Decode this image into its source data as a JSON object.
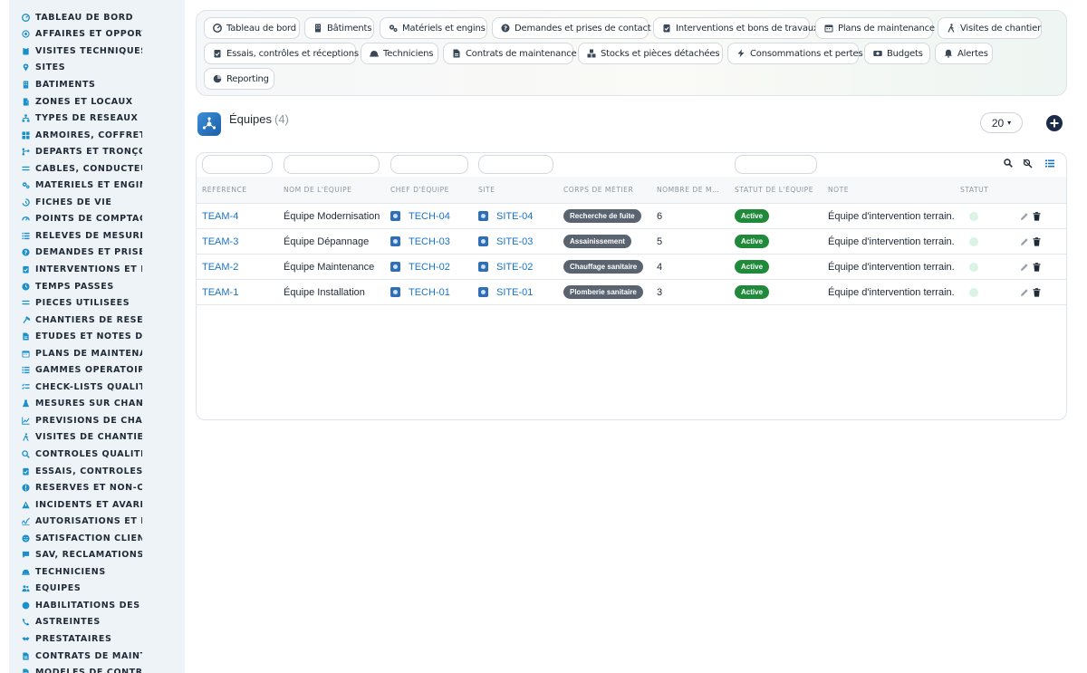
{
  "sidebar": {
    "items": [
      {
        "label": "TABLEAU DE BORD",
        "icon": "dashboard-icon"
      },
      {
        "label": "AFFAIRES ET OPPORTUNITÉS",
        "icon": "target-icon"
      },
      {
        "label": "VISITES TECHNIQUES ET RELEVÉS",
        "icon": "clipboard-icon"
      },
      {
        "label": "SITES",
        "icon": "location-pin-icon"
      },
      {
        "label": "BÂTIMENTS",
        "icon": "building-icon"
      },
      {
        "label": "ZONES ET LOCAUX",
        "icon": "door-icon"
      },
      {
        "label": "TYPES DE RÉSEAUX (BT / HTA)",
        "icon": "network-icon"
      },
      {
        "label": "ARMOIRES, COFFRETS ET TABLEAUX",
        "icon": "grid-icon"
      },
      {
        "label": "DÉPARTS ET TRONÇONS",
        "icon": "branch-icon"
      },
      {
        "label": "CÂBLES, CONDUCTEURS",
        "icon": "lines-icon"
      },
      {
        "label": "MATÉRIELS ET ENGINS",
        "icon": "gears-icon"
      },
      {
        "label": "FICHES DE VIE",
        "icon": "history-icon"
      },
      {
        "label": "POINTS DE COMPTAGE ET MESURE",
        "icon": "gauge-icon"
      },
      {
        "label": "RELEVÉS DE MESURES",
        "icon": "list-icon"
      },
      {
        "label": "DEMANDES ET PRISES DE CONTACT",
        "icon": "question-icon"
      },
      {
        "label": "INTERVENTIONS ET BONS DE TRAVAUX",
        "icon": "clipboard-check-icon"
      },
      {
        "label": "TEMPS PASSÉS",
        "icon": "clock-icon"
      },
      {
        "label": "PIÈCES UTILISÉES",
        "icon": "lines-icon"
      },
      {
        "label": "CHANTIERS DE RÉSEAUX",
        "icon": "hammer-icon"
      },
      {
        "label": "ÉTUDES ET NOTES DE CALCUL",
        "icon": "document-icon"
      },
      {
        "label": "PLANS DE MAINTENANCE",
        "icon": "calendar-icon"
      },
      {
        "label": "GAMMES OPÉRATOIRES",
        "icon": "list-icon"
      },
      {
        "label": "CHECK-LISTS QUALITÉ",
        "icon": "checklist-icon"
      },
      {
        "label": "MESURES SUR CHANTIER",
        "icon": "flask-icon"
      },
      {
        "label": "PRÉVISIONS DE CHANTIER",
        "icon": "chart-line-icon"
      },
      {
        "label": "VISITES DE CHANTIER",
        "icon": "walk-icon"
      },
      {
        "label": "CONTRÔLES QUALITÉ",
        "icon": "magnifier-icon"
      },
      {
        "label": "ESSAIS, CONTRÔLES ET RÉCEPTIONS",
        "icon": "clipboard-check-icon"
      },
      {
        "label": "RÉSERVES ET NON-CONFORMITÉS",
        "icon": "alert-circle-icon"
      },
      {
        "label": "INCIDENTS ET AVARIES",
        "icon": "warning-triangle-icon"
      },
      {
        "label": "AUTORISATIONS ET DICT",
        "icon": "signature-icon"
      },
      {
        "label": "SATISFACTION CLIENT",
        "icon": "smile-icon"
      },
      {
        "label": "SAV, RÉCLAMATIONS ET GARANTIES",
        "icon": "chat-icon"
      },
      {
        "label": "TECHNICIENS",
        "icon": "hard-hat-icon"
      },
      {
        "label": "ÉQUIPES",
        "icon": "users-icon"
      },
      {
        "label": "HABILITATIONS DES ÉQUIPES",
        "icon": "badge-icon"
      },
      {
        "label": "ASTREINTES",
        "icon": "phone-icon"
      },
      {
        "label": "PRESTATAIRES",
        "icon": "handshake-icon"
      },
      {
        "label": "CONTRATS DE MAINTENANCE",
        "icon": "document-icon"
      },
      {
        "label": "MODÈLES DE CONTRATS",
        "icon": "document-icon"
      }
    ]
  },
  "nav_chips": [
    {
      "label": "Tableau de bord",
      "icon": "dashboard-icon"
    },
    {
      "label": "Bâtiments",
      "icon": "building-icon"
    },
    {
      "label": "Matériels et engins",
      "icon": "gears-icon"
    },
    {
      "label": "Demandes et prises de contact",
      "icon": "question-icon"
    },
    {
      "label": "Interventions et bons de travaux",
      "icon": "clipboard-check-icon"
    },
    {
      "label": "Plans de maintenance",
      "icon": "calendar-icon"
    },
    {
      "label": "Visites de chantier",
      "icon": "walk-icon"
    },
    {
      "label": "Essais, contrôles et réceptions",
      "icon": "clipboard-check-icon"
    },
    {
      "label": "Techniciens",
      "icon": "hard-hat-icon"
    },
    {
      "label": "Contrats de maintenance",
      "icon": "document-icon"
    },
    {
      "label": "Stocks et pièces détachées",
      "icon": "boxes-icon"
    },
    {
      "label": "Consommations et pertes",
      "icon": "bolt-icon"
    },
    {
      "label": "Budgets",
      "icon": "money-icon"
    },
    {
      "label": "Alertes",
      "icon": "bell-icon"
    },
    {
      "label": "Reporting",
      "icon": "pie-chart-icon"
    }
  ],
  "header": {
    "title": "Équipes",
    "count": "(4)",
    "page_size": "20"
  },
  "table": {
    "columns": [
      "RÉFÉRENCE",
      "NOM DE L'ÉQUIPE",
      "CHEF D'ÉQUIPE",
      "SITE",
      "CORPS DE MÉTIER",
      "NOMBRE DE MEMBRES",
      "STATUT DE L'ÉQUIPE",
      "NOTE",
      "STATUT"
    ],
    "rows": [
      {
        "ref": "TEAM-4",
        "name": "Équipe Modernisation",
        "chief": "TECH-04",
        "site": "SITE-04",
        "trade": "Recherche de fuite",
        "members": "6",
        "status": "Active",
        "note": "Équipe d'intervention terrain."
      },
      {
        "ref": "TEAM-3",
        "name": "Équipe Dépannage",
        "chief": "TECH-03",
        "site": "SITE-03",
        "trade": "Assainissement",
        "members": "5",
        "status": "Active",
        "note": "Équipe d'intervention terrain."
      },
      {
        "ref": "TEAM-2",
        "name": "Équipe Maintenance",
        "chief": "TECH-02",
        "site": "SITE-02",
        "trade": "Chauffage sanitaire",
        "members": "4",
        "status": "Active",
        "note": "Équipe d'intervention terrain."
      },
      {
        "ref": "TEAM-1",
        "name": "Équipe Installation",
        "chief": "TECH-01",
        "site": "SITE-01",
        "trade": "Plomberie sanitaire",
        "members": "3",
        "status": "Active",
        "note": "Équipe d'intervention terrain."
      }
    ]
  },
  "colors": {
    "link": "#1a73c5",
    "status_active": "#1e8a3a",
    "trade_badge": "#5a6471",
    "sidebar_bg": "#eef3f8",
    "add_button": "#1c2b4a"
  }
}
